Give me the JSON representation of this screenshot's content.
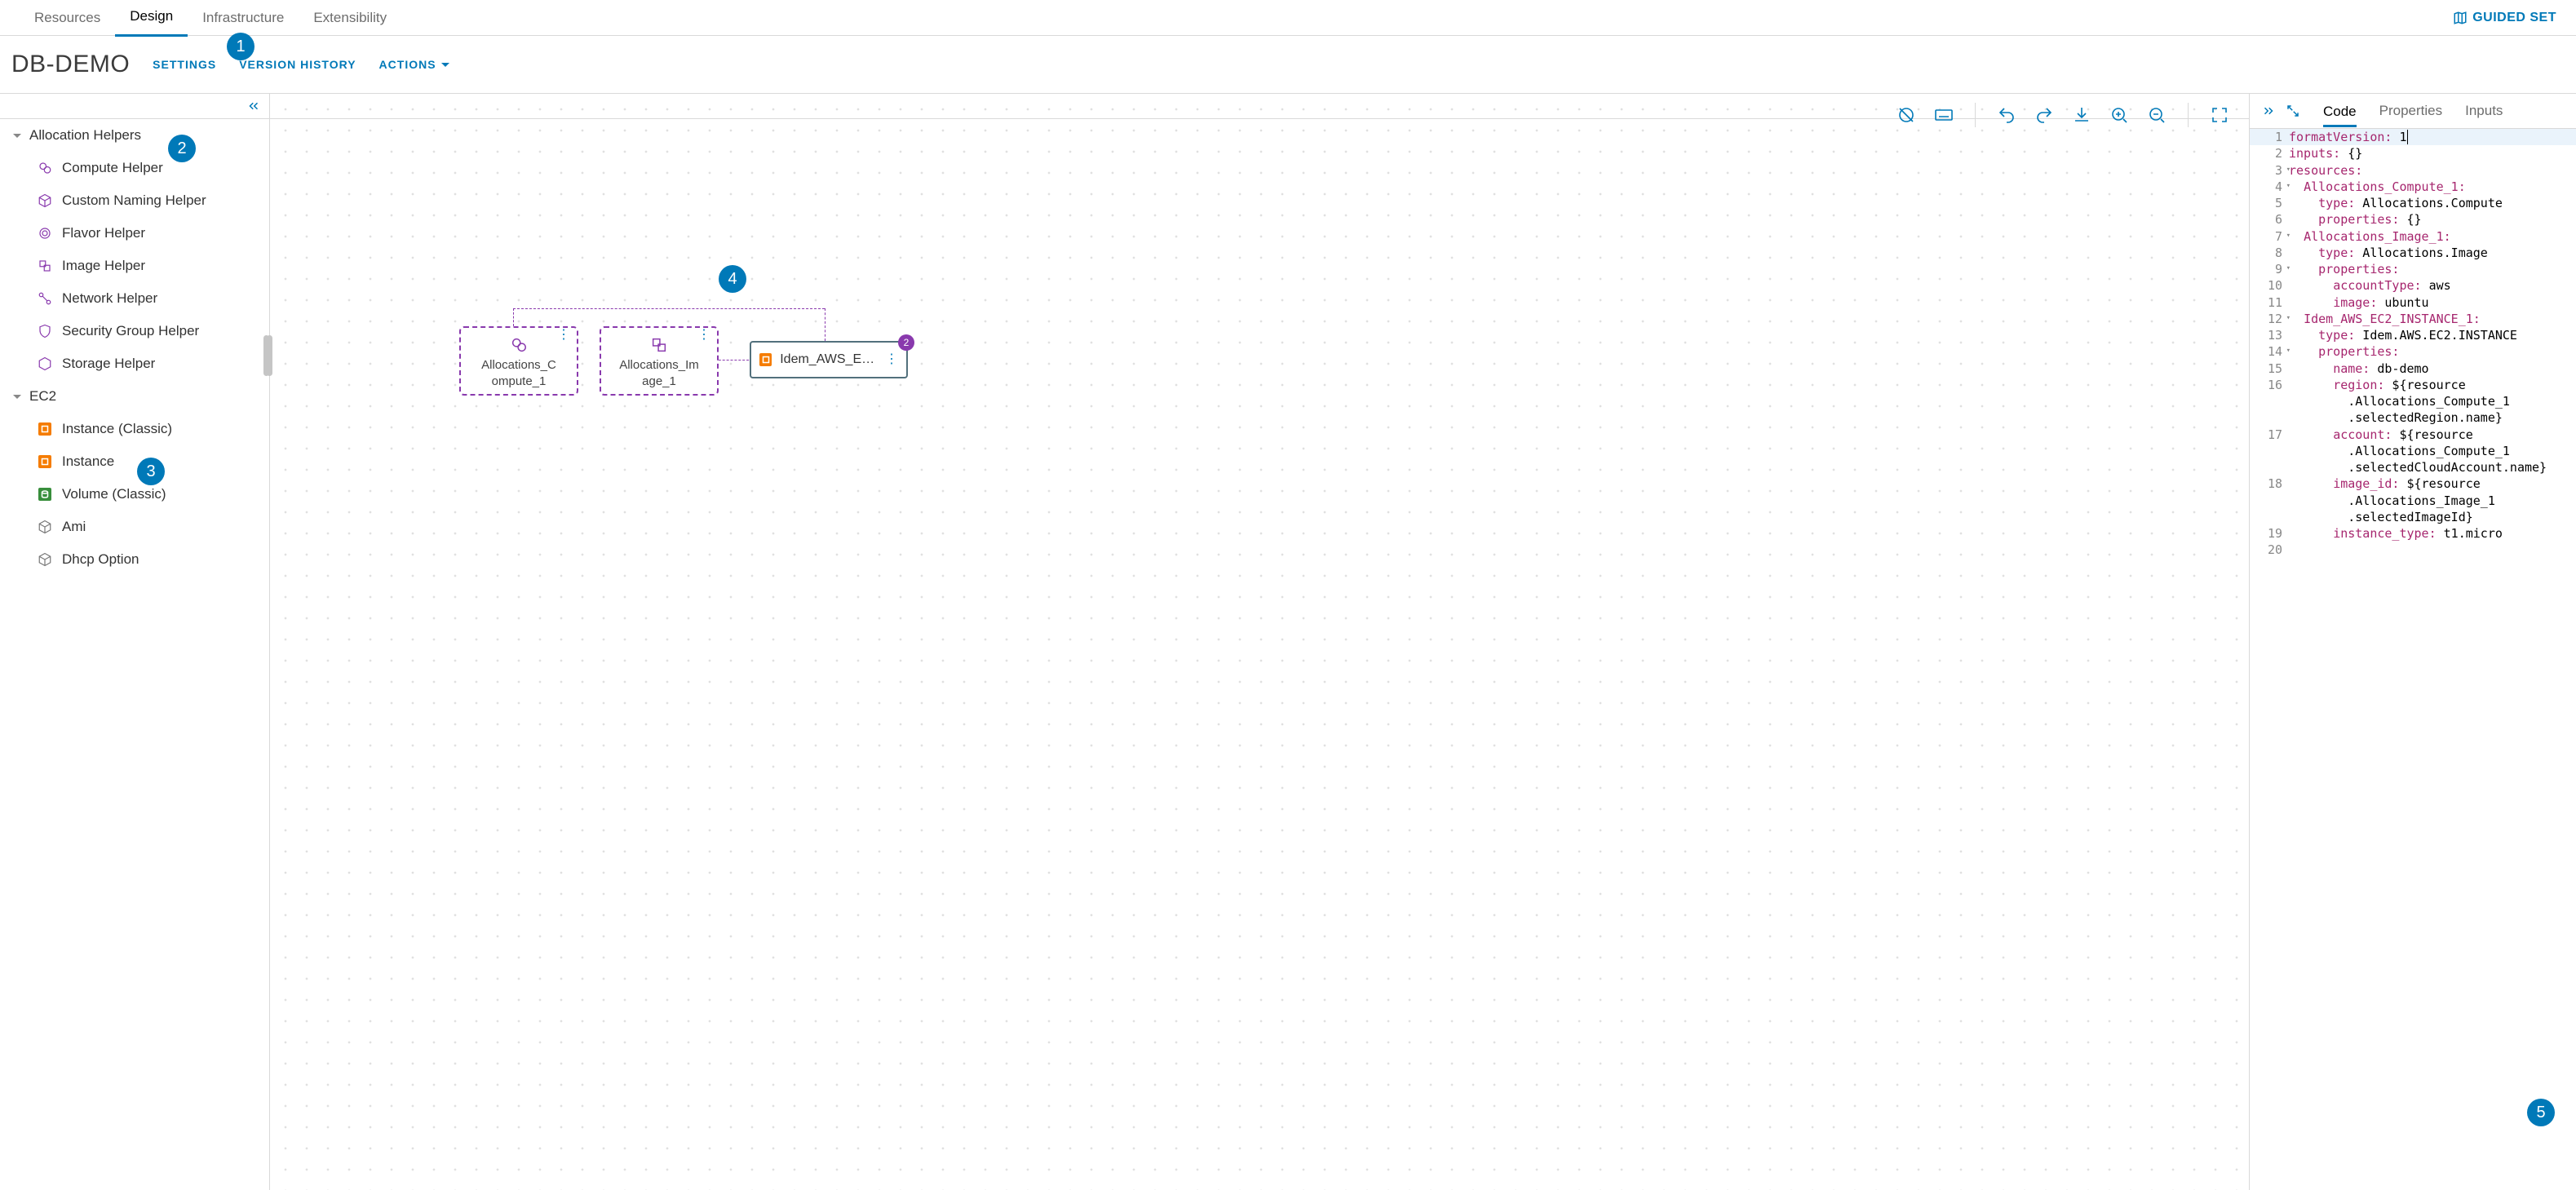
{
  "topnav": {
    "tabs": [
      "Resources",
      "Design",
      "Infrastructure",
      "Extensibility"
    ],
    "active": "Design",
    "guided": "GUIDED SET"
  },
  "titlebar": {
    "title": "DB-DEMO",
    "settings": "SETTINGS",
    "version_history": "VERSION HISTORY",
    "actions": "ACTIONS"
  },
  "palette": {
    "sections": [
      {
        "name": "Allocation Helpers",
        "items": [
          {
            "label": "Compute Helper",
            "icon": "compute",
            "style": "purple"
          },
          {
            "label": "Custom Naming Helper",
            "icon": "cube",
            "style": "purple-outline"
          },
          {
            "label": "Flavor Helper",
            "icon": "flavor",
            "style": "purple"
          },
          {
            "label": "Image Helper",
            "icon": "image",
            "style": "purple"
          },
          {
            "label": "Network Helper",
            "icon": "network",
            "style": "purple"
          },
          {
            "label": "Security Group Helper",
            "icon": "security",
            "style": "purple"
          },
          {
            "label": "Storage Helper",
            "icon": "storage",
            "style": "purple-outline"
          }
        ]
      },
      {
        "name": "EC2",
        "items": [
          {
            "label": "Instance (Classic)",
            "icon": "instance",
            "style": "orange"
          },
          {
            "label": "Instance",
            "icon": "instance",
            "style": "orange"
          },
          {
            "label": "Volume (Classic)",
            "icon": "volume",
            "style": "green"
          },
          {
            "label": "Ami",
            "icon": "cube",
            "style": "outline"
          },
          {
            "label": "Dhcp Option",
            "icon": "cube",
            "style": "outline"
          }
        ]
      }
    ]
  },
  "canvas": {
    "nodes": {
      "compute": {
        "label_l1": "Allocations_C",
        "label_l2": "ompute_1"
      },
      "image": {
        "label_l1": "Allocations_Im",
        "label_l2": "age_1"
      },
      "ec2": {
        "label": "Idem_AWS_EC...",
        "badge": "2"
      }
    }
  },
  "codepanel": {
    "tabs": [
      "Code",
      "Properties",
      "Inputs"
    ],
    "active": "Code",
    "lines": [
      {
        "n": 1,
        "fold": "",
        "hl": true,
        "seg": [
          {
            "t": "k",
            "x": "formatVersion:"
          },
          {
            "t": "v",
            "x": " 1"
          }
        ],
        "cursor": true
      },
      {
        "n": 2,
        "fold": "",
        "seg": [
          {
            "t": "k",
            "x": "inputs:"
          },
          {
            "t": "v",
            "x": " {}"
          }
        ]
      },
      {
        "n": 3,
        "fold": "▾",
        "seg": [
          {
            "t": "k",
            "x": "resources:"
          }
        ]
      },
      {
        "n": 4,
        "fold": "▾",
        "seg": [
          {
            "t": "v",
            "x": "  "
          },
          {
            "t": "k",
            "x": "Allocations_Compute_1:"
          }
        ]
      },
      {
        "n": 5,
        "fold": "",
        "seg": [
          {
            "t": "v",
            "x": "    "
          },
          {
            "t": "k",
            "x": "type:"
          },
          {
            "t": "v",
            "x": " Allocations.Compute"
          }
        ]
      },
      {
        "n": 6,
        "fold": "",
        "seg": [
          {
            "t": "v",
            "x": "    "
          },
          {
            "t": "k",
            "x": "properties:"
          },
          {
            "t": "v",
            "x": " {}"
          }
        ]
      },
      {
        "n": 7,
        "fold": "▾",
        "seg": [
          {
            "t": "v",
            "x": "  "
          },
          {
            "t": "k",
            "x": "Allocations_Image_1:"
          }
        ]
      },
      {
        "n": 8,
        "fold": "",
        "seg": [
          {
            "t": "v",
            "x": "    "
          },
          {
            "t": "k",
            "x": "type:"
          },
          {
            "t": "v",
            "x": " Allocations.Image"
          }
        ]
      },
      {
        "n": 9,
        "fold": "▾",
        "seg": [
          {
            "t": "v",
            "x": "    "
          },
          {
            "t": "k",
            "x": "properties:"
          }
        ]
      },
      {
        "n": 10,
        "fold": "",
        "seg": [
          {
            "t": "v",
            "x": "      "
          },
          {
            "t": "k",
            "x": "accountType:"
          },
          {
            "t": "v",
            "x": " aws"
          }
        ]
      },
      {
        "n": 11,
        "fold": "",
        "seg": [
          {
            "t": "v",
            "x": "      "
          },
          {
            "t": "k",
            "x": "image:"
          },
          {
            "t": "v",
            "x": " ubuntu"
          }
        ]
      },
      {
        "n": 12,
        "fold": "▾",
        "seg": [
          {
            "t": "v",
            "x": "  "
          },
          {
            "t": "k",
            "x": "Idem_AWS_EC2_INSTANCE_1:"
          }
        ]
      },
      {
        "n": 13,
        "fold": "",
        "seg": [
          {
            "t": "v",
            "x": "    "
          },
          {
            "t": "k",
            "x": "type:"
          },
          {
            "t": "v",
            "x": " Idem.AWS.EC2.INSTANCE"
          }
        ]
      },
      {
        "n": 14,
        "fold": "▾",
        "seg": [
          {
            "t": "v",
            "x": "    "
          },
          {
            "t": "k",
            "x": "properties:"
          }
        ]
      },
      {
        "n": 15,
        "fold": "",
        "seg": [
          {
            "t": "v",
            "x": "      "
          },
          {
            "t": "k",
            "x": "name:"
          },
          {
            "t": "v",
            "x": " db-demo"
          }
        ]
      },
      {
        "n": 16,
        "fold": "",
        "seg": [
          {
            "t": "v",
            "x": "      "
          },
          {
            "t": "k",
            "x": "region:"
          },
          {
            "t": "v",
            "x": " ${resource"
          }
        ]
      },
      {
        "n": "",
        "fold": "",
        "seg": [
          {
            "t": "v",
            "x": "        .Allocations_Compute_1"
          }
        ]
      },
      {
        "n": "",
        "fold": "",
        "seg": [
          {
            "t": "v",
            "x": "        .selectedRegion.name}"
          }
        ]
      },
      {
        "n": 17,
        "fold": "",
        "seg": [
          {
            "t": "v",
            "x": "      "
          },
          {
            "t": "k",
            "x": "account:"
          },
          {
            "t": "v",
            "x": " ${resource"
          }
        ]
      },
      {
        "n": "",
        "fold": "",
        "seg": [
          {
            "t": "v",
            "x": "        .Allocations_Compute_1"
          }
        ]
      },
      {
        "n": "",
        "fold": "",
        "seg": [
          {
            "t": "v",
            "x": "        .selectedCloudAccount.name}"
          }
        ]
      },
      {
        "n": 18,
        "fold": "",
        "seg": [
          {
            "t": "v",
            "x": "      "
          },
          {
            "t": "k",
            "x": "image_id:"
          },
          {
            "t": "v",
            "x": " ${resource"
          }
        ]
      },
      {
        "n": "",
        "fold": "",
        "seg": [
          {
            "t": "v",
            "x": "        .Allocations_Image_1"
          }
        ]
      },
      {
        "n": "",
        "fold": "",
        "seg": [
          {
            "t": "v",
            "x": "        .selectedImageId}"
          }
        ]
      },
      {
        "n": 19,
        "fold": "",
        "seg": [
          {
            "t": "v",
            "x": "      "
          },
          {
            "t": "k",
            "x": "instance_type:"
          },
          {
            "t": "v",
            "x": " t1.micro"
          }
        ]
      },
      {
        "n": 20,
        "fold": "",
        "seg": []
      }
    ]
  },
  "callouts": {
    "c1": "1",
    "c2": "2",
    "c3": "3",
    "c4": "4",
    "c5": "5"
  }
}
